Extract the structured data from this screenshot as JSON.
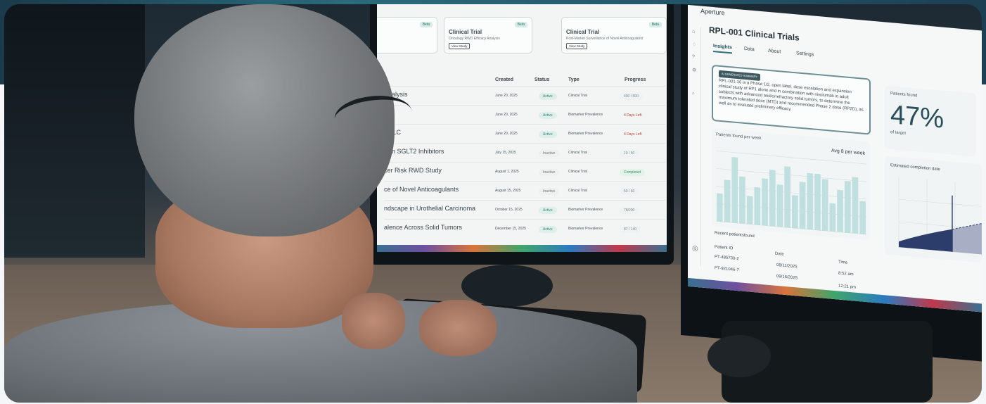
{
  "left_screen": {
    "cards": [
      {
        "badge": "Beta",
        "title": "",
        "sub": "",
        "button": ""
      },
      {
        "badge": "Beta",
        "title": "Clinical Trial",
        "sub": "Oncology RWD Efficacy Analysis",
        "button": "View Study"
      },
      {
        "badge": "Beta",
        "title": "Clinical Trial",
        "sub": "Post-Market Surveillance of Novel Anticoagulants",
        "button": "View Study"
      }
    ],
    "columns": [
      "Created",
      "Status",
      "Type",
      "Progress"
    ],
    "rows": [
      {
        "name": "Analysis",
        "created": "June 20, 2025",
        "status": "Active",
        "type": "Clinical Trial",
        "progress": "400 / 500"
      },
      {
        "name": "",
        "created": "June 20, 2025",
        "status": "Active",
        "type": "Biomarker Prevalence",
        "progress": "4 Days Left"
      },
      {
        "name": "SCLC",
        "created": "June 20, 2025",
        "status": "Active",
        "type": "Biomarker Prevalence",
        "progress": "4 Days Left"
      },
      {
        "name": "with SGLT2 Inhibitors",
        "created": "July 15, 2025",
        "status": "Inactive",
        "type": "Clinical Trial",
        "progress": "10 / 50"
      },
      {
        "name": "cer Risk RWD Study",
        "created": "August 1, 2025",
        "status": "Inactive",
        "type": "Clinical Trial",
        "progress": "Completed"
      },
      {
        "name": "ce of Novel Anticoagulants",
        "created": "August 15, 2025",
        "status": "Inactive",
        "type": "Clinical Trial",
        "progress": "50 / 60"
      },
      {
        "name": "ndscape in Urothelial Carcinoma",
        "created": "October 15, 2025",
        "status": "Active",
        "type": "Biomarker Prevalence",
        "progress": "78/200"
      },
      {
        "name": "alence Across Solid Tumors",
        "created": "December 15, 2025",
        "status": "Active",
        "type": "Biomarker Prevalence",
        "progress": "87 / 140"
      }
    ]
  },
  "right_screen": {
    "brand": "Aperture",
    "title": "RPL-001 Clinical Trials",
    "tabs": [
      "Insights",
      "Data",
      "About",
      "Settings"
    ],
    "summary_tag": "AI GENERATED SUMMARY",
    "summary": "RPL-001-16 is a Phase 1/2, open label, dose escalation and expansion clinical study of RP1 alone and in combination with nivolumab in adult subjects with advanced and/orrefractory solid tumors, to determine the maximum tolerated dose (MTD) and recommended Phase 2 dose (RP2D), as well as to evaluate preliminary efficacy.",
    "patients_found_label": "Patients found",
    "patients_found_value": "47%",
    "patients_found_sub": "of target",
    "weekly_label": "Patients found per week",
    "weekly_avg": "Avg 8 per week",
    "completion_label": "Estimated completion date",
    "recent_label": "Recent patientsfound",
    "recent_columns": [
      "Patient ID",
      "Date",
      "Time"
    ],
    "recent_rows": [
      {
        "id": "PT-485730-2",
        "date": "08/11/2025",
        "time": "8:52 am"
      },
      {
        "id": "PT-921046-7",
        "date": "09/16/2025",
        "time": "12:21 pm"
      }
    ]
  },
  "chart_data": {
    "type": "bar",
    "title": "Patients found per week",
    "annotation": "Avg 8 per week",
    "values": [
      6,
      9,
      14,
      10,
      6,
      8,
      10,
      12,
      9,
      13,
      7,
      10,
      12,
      12,
      11,
      6,
      9,
      11,
      12,
      7
    ],
    "grid": true
  },
  "colors": {
    "accent": "#2f6f7d",
    "bar": "#bfe0df",
    "area": "#2d3d6b"
  }
}
